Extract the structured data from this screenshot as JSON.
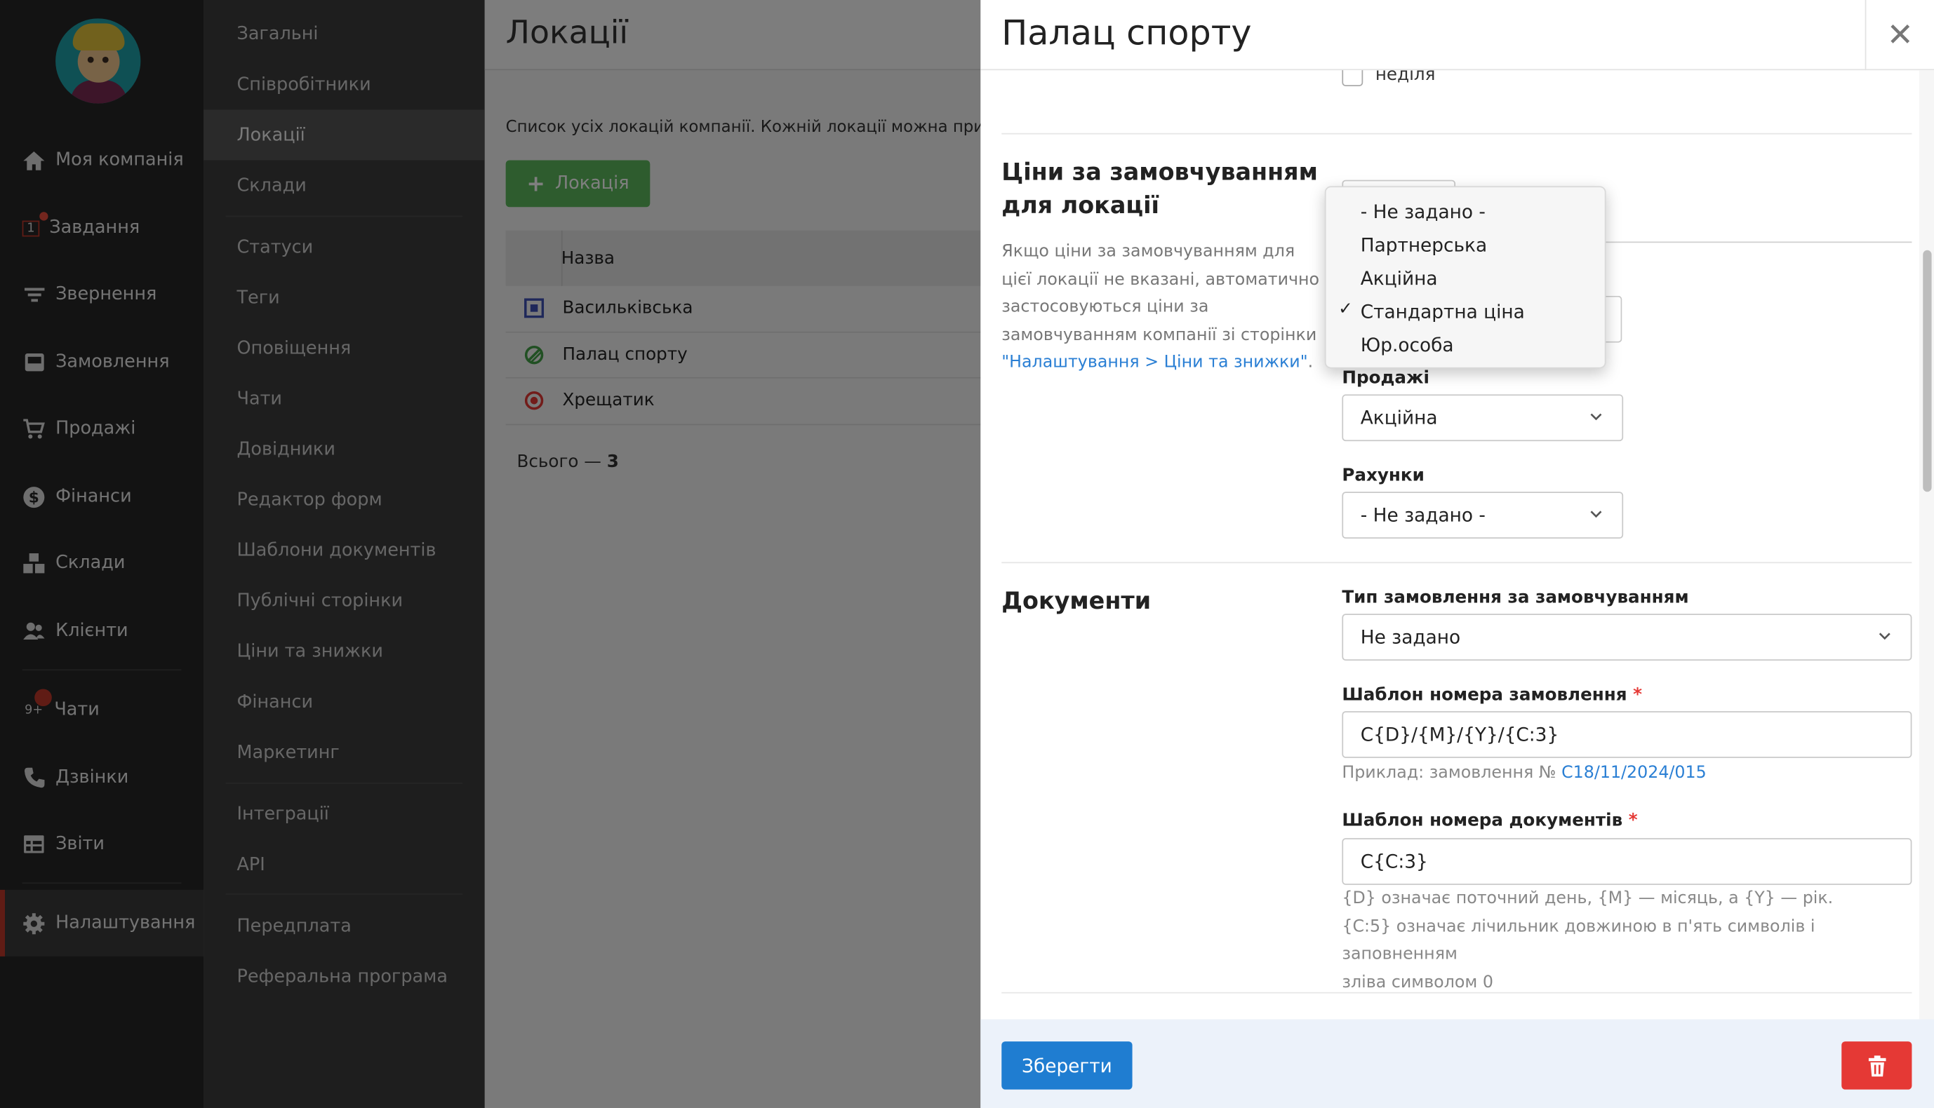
{
  "main_nav": {
    "items": [
      {
        "label": "Моя компанія",
        "icon": "home-icon"
      },
      {
        "label": "Завдання",
        "icon": "tasks-icon",
        "badge": "1"
      },
      {
        "label": "Звернення",
        "icon": "filter-icon"
      },
      {
        "label": "Замовлення",
        "icon": "inbox-icon"
      },
      {
        "label": "Продажі",
        "icon": "cart-icon"
      },
      {
        "label": "Фінанси",
        "icon": "dollar-icon"
      },
      {
        "label": "Склади",
        "icon": "boxes-icon"
      },
      {
        "label": "Клієнти",
        "icon": "users-icon"
      },
      {
        "label": "Чати",
        "icon": "chat-icon",
        "badge": "9+"
      },
      {
        "label": "Дзвінки",
        "icon": "phone-icon"
      },
      {
        "label": "Звіти",
        "icon": "table-icon"
      },
      {
        "label": "Налаштування",
        "icon": "gear-icon"
      }
    ]
  },
  "submenu": {
    "items": [
      "Загальні",
      "Співробітники",
      "Локації",
      "Склади",
      "Статуси",
      "Теги",
      "Оповіщення",
      "Чати",
      "Довідники",
      "Редактор форм",
      "Шаблони документів",
      "Публічні сторінки",
      "Ціни та знижки",
      "Фінанси",
      "Маркетинг",
      "Інтеграції",
      "API",
      "Передплата",
      "Реферальна програма"
    ],
    "active": "Локації"
  },
  "content": {
    "title": "Локації",
    "description": "Список усіх локацій компанії. Кожній локації можна призн",
    "add_button": "Локація",
    "table_header": "Назва",
    "rows": [
      {
        "name": "Васильківська",
        "color": "#3f51b5"
      },
      {
        "name": "Палац спорту",
        "color": "#43a047"
      },
      {
        "name": "Хрещатик",
        "color": "#e53935"
      }
    ],
    "total_label": "Всього — ",
    "total_value": "3"
  },
  "panel": {
    "title": "Палац спорту",
    "checkbox_label": "неділя",
    "prices": {
      "title": "Ціни за замовчуванням для локації",
      "desc": "Якщо ціни за замовчуванням для цієї локації не вказані, автоматично застосовуються ціни за замовчуванням компанії зі сторінки ",
      "desc_link": "\"Налаштування > Ціни та знижки\"",
      "desc_end": ".",
      "sales_label": "Продажі",
      "sales_value": "Акційна",
      "invoices_label": "Рахунки",
      "invoices_value": "- Не задано -",
      "dropdown_options": [
        "- Не задано -",
        "Партнерська",
        "Акційна",
        "Стандартна ціна",
        "Юр.особа"
      ],
      "dropdown_selected": "Стандартна ціна"
    },
    "documents": {
      "title": "Документи",
      "order_type_label": "Тип замовлення за замовчуванням",
      "order_type_value": "Не задано",
      "order_number_label": "Шаблон номера замовлення",
      "order_number_value": "C{D}/{M}/{Y}/{C:3}",
      "example_prefix": "Приклад: замовлення № ",
      "example_value": "C18/11/2024/015",
      "doc_number_label": "Шаблон номера документів",
      "doc_number_value": "C{C:3}",
      "hint_line1": "{D} означає поточний день, {M} — місяць, а {Y} — рік.",
      "hint_line2": "{C:5} означає лічильник довжиною в п'ять символів і заповненням",
      "hint_line3": "зліва символом 0"
    },
    "save_button": "Зберегти"
  },
  "colors": {
    "accent": "#1f7dd1",
    "danger": "#e53935",
    "success": "#5cb85c",
    "nav_bg": "#262626",
    "submenu_bg": "#3d3d3d"
  }
}
